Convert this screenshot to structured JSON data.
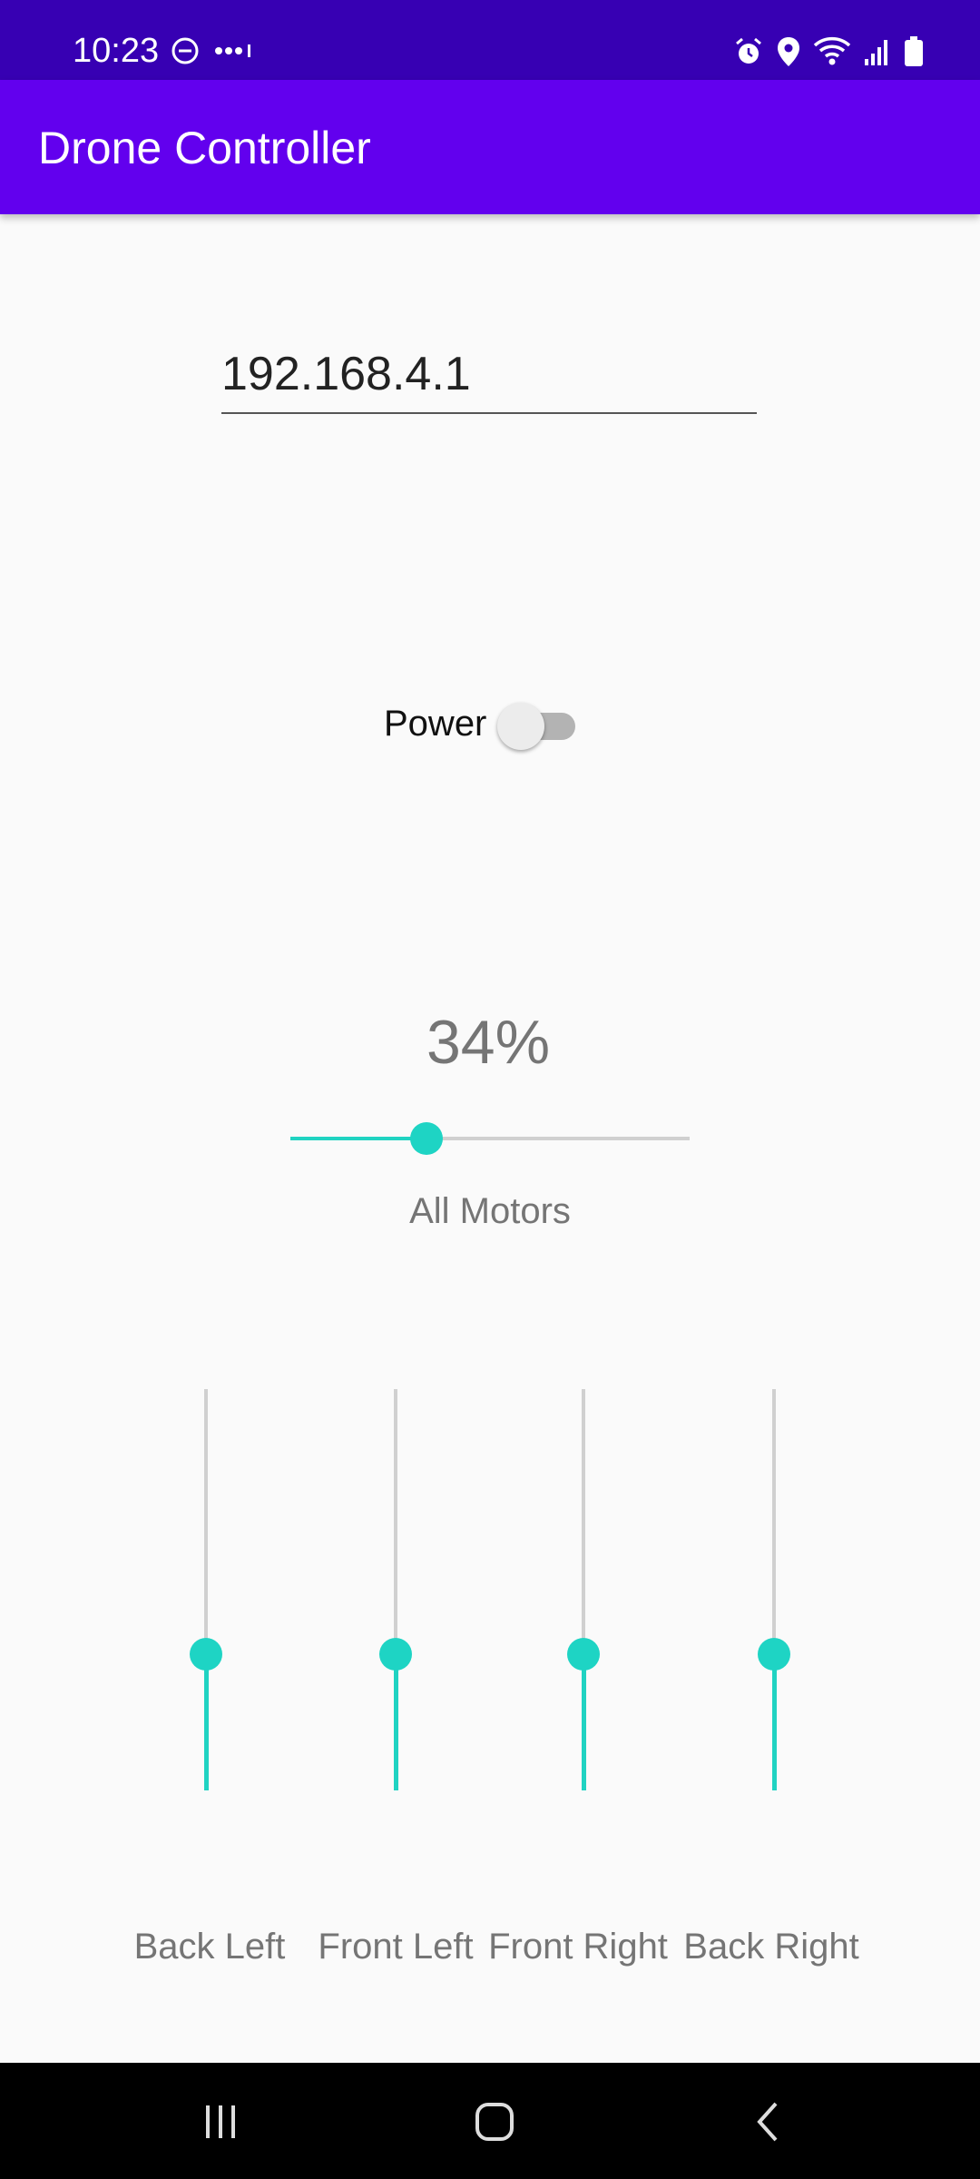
{
  "status_bar": {
    "time": "10:23",
    "left_icons": [
      "do-not-disturb-icon",
      "more-notifications-icon"
    ],
    "right_icons": [
      "alarm-icon",
      "location-icon",
      "wifi-icon",
      "signal-icon",
      "battery-icon"
    ]
  },
  "app_bar": {
    "title": "Drone Controller"
  },
  "ip_field": {
    "value": "192.168.4.1"
  },
  "power": {
    "label": "Power",
    "on": false
  },
  "all_motors": {
    "percent_text": "34%",
    "value_percent": 34,
    "label": "All Motors"
  },
  "motors": [
    {
      "label": "Back Left",
      "value_percent": 34
    },
    {
      "label": "Front Left",
      "value_percent": 34
    },
    {
      "label": "Front Right",
      "value_percent": 34
    },
    {
      "label": "Back Right",
      "value_percent": 34
    }
  ],
  "colors": {
    "status_bar": "#3700b3",
    "app_bar": "#6200ee",
    "accent": "#1ed4c4",
    "track": "#d0d0d0",
    "background": "#fafafa"
  },
  "nav_bar": {
    "buttons": [
      "recent-apps-icon",
      "home-icon",
      "back-icon"
    ]
  }
}
